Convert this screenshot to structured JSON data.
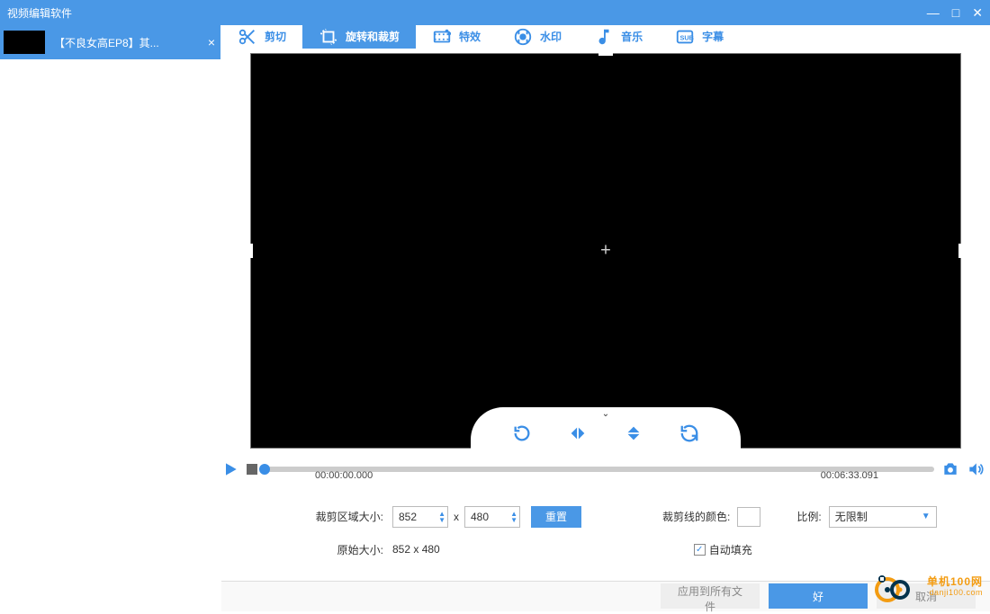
{
  "window": {
    "title": "视频编辑软件"
  },
  "sidebar": {
    "items": [
      {
        "label": "【不良女高EP8】其..."
      }
    ]
  },
  "tabs": [
    {
      "id": "cut",
      "label": "剪切"
    },
    {
      "id": "rotate-crop",
      "label": "旋转和裁剪",
      "active": true
    },
    {
      "id": "effects",
      "label": "特效"
    },
    {
      "id": "watermark",
      "label": "水印"
    },
    {
      "id": "music",
      "label": "音乐"
    },
    {
      "id": "subtitle",
      "label": "字幕"
    }
  ],
  "timeline": {
    "start": "00:00:00.000",
    "end": "00:06:33.091"
  },
  "settings": {
    "crop_size_label": "裁剪区域大小:",
    "width": "852",
    "height": "480",
    "x_separator": "x",
    "reset_label": "重置",
    "line_color_label": "裁剪线的颜色:",
    "ratio_label": "比例:",
    "ratio_value": "无限制",
    "original_size_label": "原始大小:",
    "original_size_value": "852 x 480",
    "autofill_label": "自动填充",
    "autofill_checked": true
  },
  "footer": {
    "apply_all": "应用到所有文件",
    "ok": "好",
    "cancel": "取消"
  },
  "watermark_brand": {
    "line1": "单机100网",
    "line2": "danji100.com"
  }
}
